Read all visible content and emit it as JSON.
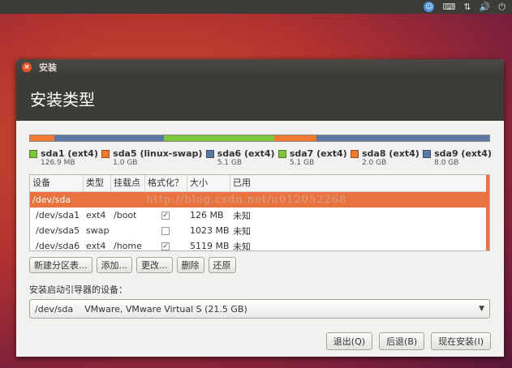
{
  "window": {
    "title": "安装",
    "heading": "安装类型"
  },
  "topbar": {
    "keyboard_icon": "keyboard-icon",
    "network_icon": "network-icon",
    "volume_icon": "volume-icon"
  },
  "partitions": [
    {
      "name": "sda1 (ext4)",
      "size": "126.9 MB",
      "color": "#f07a2e"
    },
    {
      "name": "sda5 (linux-swap)",
      "size": "1.0 GB",
      "color": "#f07a2e"
    },
    {
      "name": "sda6 (ext4)",
      "size": "5.1 GB",
      "color": "#5b78a6"
    },
    {
      "name": "sda7 (ext4)",
      "size": "5.1 GB",
      "color": "#7cc63b"
    },
    {
      "name": "sda8 (ext4)",
      "size": "2.0 GB",
      "color": "#f07a2e"
    },
    {
      "name": "sda9 (ext4)",
      "size": "8.0 GB",
      "color": "#5b78a6"
    }
  ],
  "table": {
    "columns": [
      "设备",
      "类型",
      "挂载点",
      "格式化？",
      "大小",
      "已用"
    ],
    "disk": "/dev/sda",
    "rows": [
      {
        "device": "/dev/sda1",
        "type": "ext4",
        "mount": "/boot",
        "format": true,
        "size": "126 MB",
        "used": "未知"
      },
      {
        "device": "/dev/sda5",
        "type": "swap",
        "mount": "",
        "format": false,
        "size": "1023 MB",
        "used": "未知"
      },
      {
        "device": "/dev/sda6",
        "type": "ext4",
        "mount": "/home",
        "format": true,
        "size": "5119 MB",
        "used": "未知"
      }
    ]
  },
  "buttons": {
    "new_table": "新建分区表...",
    "add": "添加...",
    "change": "更改...",
    "delete": "删除",
    "revert": "还原"
  },
  "boot": {
    "label": "安装启动引导器的设备：",
    "value": "/dev/sda    VMware, VMware Virtual S (21.5 GB)"
  },
  "actions": {
    "quit": "退出(Q)",
    "back": "后退(B)",
    "install": "现在安装(I)"
  },
  "watermark": "http://blog.csdn.net/u012052268"
}
